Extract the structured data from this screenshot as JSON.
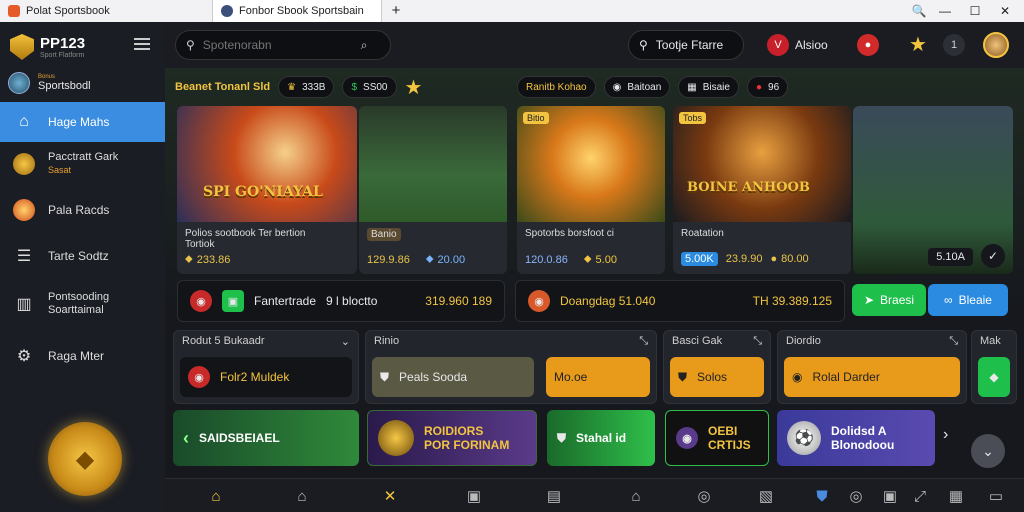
{
  "browser": {
    "tab1_title": "Polat Sportsbook",
    "tab2_title": "Fonbor Sbook Sportsbain",
    "new_tab": "+",
    "search_icon": "🔍",
    "minimize": "—",
    "maximize": "☐",
    "close": "✕"
  },
  "sidebar": {
    "logo_title": "PP123",
    "logo_sub": "Sport Flatform",
    "user_tag": "Bonus",
    "user_name": "Sportsbodl",
    "items": [
      {
        "label": "Hage Mahs",
        "icon": "house-icon"
      },
      {
        "label": "Pacctratt Gark",
        "sub": "Sasat",
        "icon": "medal-icon"
      },
      {
        "label": "Pala Racds",
        "icon": "ball-icon"
      },
      {
        "label": "Tarte Sodtz",
        "icon": "list-icon"
      },
      {
        "label": "Pontsooding",
        "sub": "Soarttaimal",
        "icon": "building-icon"
      },
      {
        "label": "Raga Mter",
        "icon": "gear-icon"
      }
    ]
  },
  "topbar": {
    "search_placeholder": "Spotenorabn",
    "pill_label": "Tootje Ftarre",
    "brand_label": "Alsioo",
    "count": "1"
  },
  "strip": {
    "title": "Beanet Tonanl Sld",
    "chip1": "333B",
    "chip2": "SS00",
    "section2_title": "Ranitb Kohao",
    "chip3": "Baitoan",
    "chip4": "Bisaie",
    "chip5": "96"
  },
  "cards": [
    {
      "banner": "SPI GO'NIAYAL",
      "caption1": "Polios sootbook Ter bertion",
      "caption2": "Tortiok",
      "odds1": "233.86",
      "odds2": ""
    },
    {
      "banner": "",
      "caption1": "Banio",
      "caption2": "",
      "odds1": "129.9.86",
      "odds2": "20.00"
    },
    {
      "tag": "Bitio",
      "caption1": "Spotorbs borsfoot ci",
      "odds1": "120.0.86",
      "odds2": "5.00"
    },
    {
      "tag": "Tobs",
      "banner": "BOINE ANHOOB",
      "caption1": "Roatation",
      "odds_chip": "5.00K",
      "odds1": "23.9.90",
      "odds2": "80.00"
    },
    {
      "score": "5.10A"
    }
  ],
  "row2": {
    "left_label": "Fantertrade",
    "left_tag": "9 l bloctto",
    "left_value": "319.960 189",
    "right_label": "Doangdag 51.040",
    "right_value": "TH 39.389.125",
    "green_btn": "Braesi",
    "blue_btn": "Bleaie"
  },
  "panels": [
    {
      "title": "Rodut 5 Bukaadr",
      "body": "Folr2 Muldek"
    },
    {
      "title": "Rinio",
      "body": "Peals Sooda",
      "body2": "Mo.oe"
    },
    {
      "title": "Basci Gak",
      "body": "Solos"
    },
    {
      "title": "Diordio",
      "body": "Rolal Darder"
    },
    {
      "title": "Mak"
    }
  ],
  "promos": [
    {
      "label": "SAIDSBEIAEL"
    },
    {
      "label": "ROIDIORS",
      "label2": "POR FORINAM"
    },
    {
      "label": "Stahal id"
    },
    {
      "label": "OEBI",
      "label2": "CRTIJS"
    },
    {
      "label": "Dolidsd A",
      "label2": "Blonodoou"
    }
  ],
  "colors": {
    "accent": "#3a8de0",
    "gold": "#f2c440",
    "green": "#1fbf4c"
  }
}
